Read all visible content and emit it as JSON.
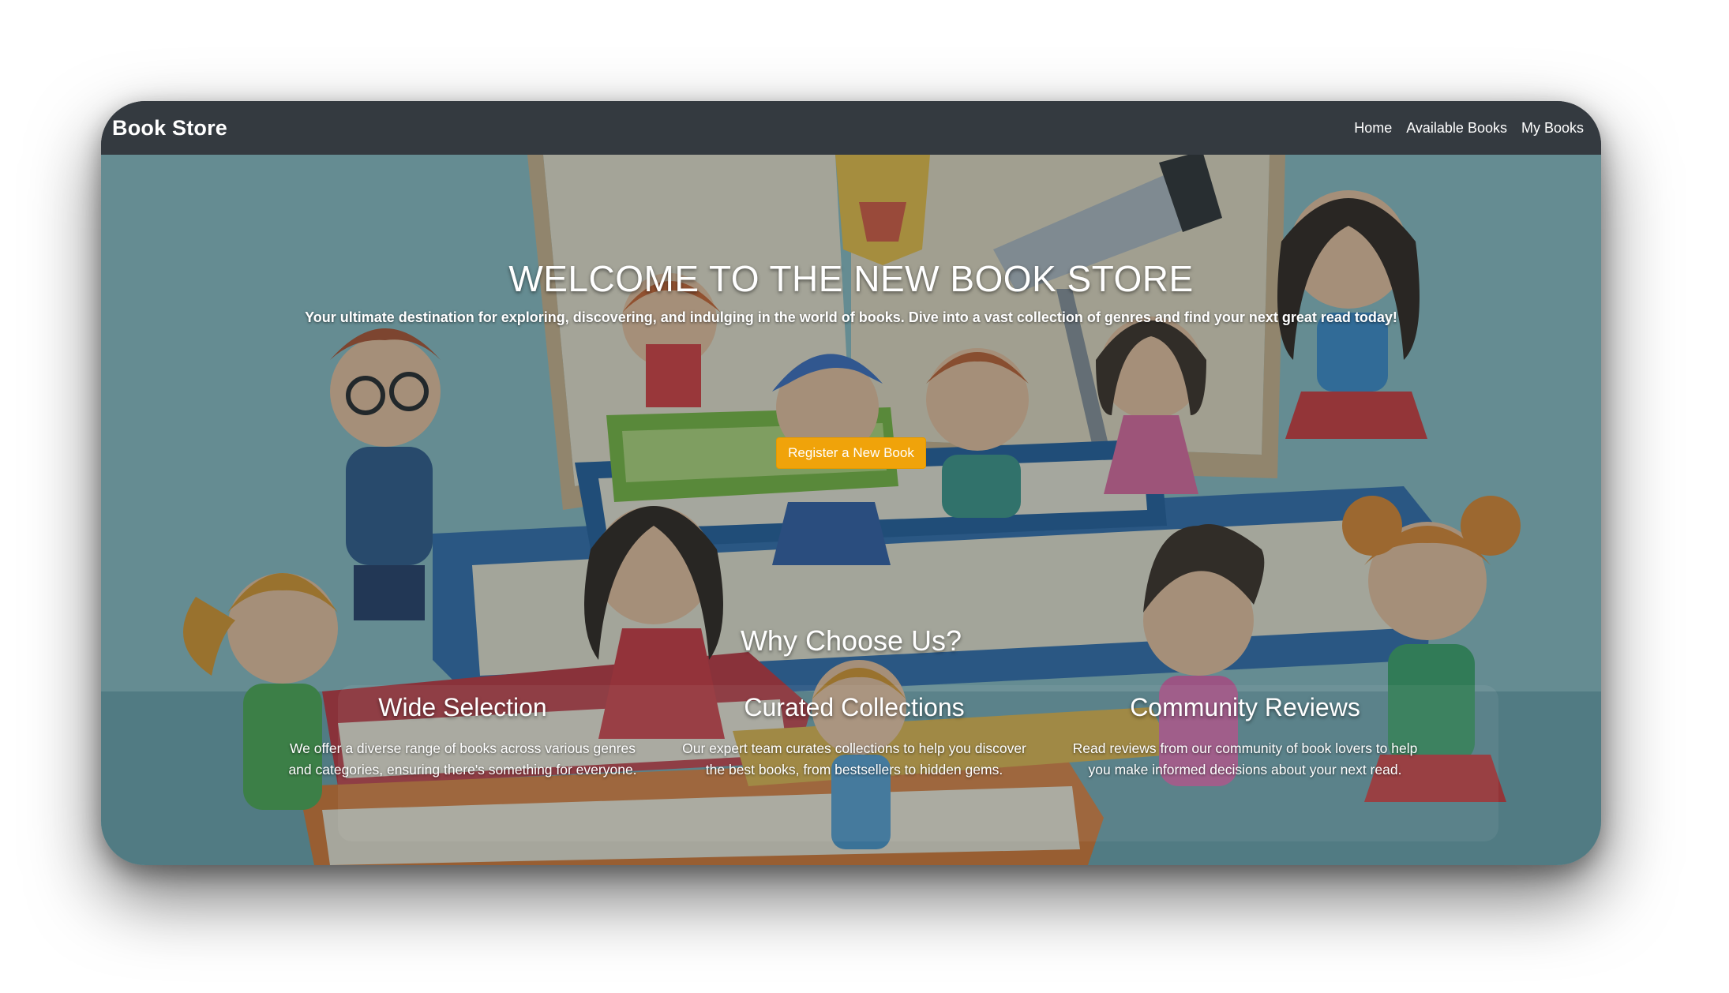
{
  "navbar": {
    "brand": "Book Store",
    "links": [
      "Home",
      "Available Books",
      "My Books"
    ]
  },
  "hero": {
    "title": "WELCOME TO THE NEW BOOK STORE",
    "subtitle": "Your ultimate destination for exploring, discovering, and indulging in the world of books. Dive into a vast collection of genres and find your next great read today!",
    "cta_label": "Register a New Book",
    "background": "kids-reading-books-illustration"
  },
  "why": {
    "title": "Why Choose Us?",
    "features": [
      {
        "title": "Wide Selection",
        "text": "We offer a diverse range of books across various genres and categories, ensuring there's something for everyone."
      },
      {
        "title": "Curated Collections",
        "text": "Our expert team curates collections to help you discover the best books, from bestsellers to hidden gems."
      },
      {
        "title": "Community Reviews",
        "text": "Read reviews from our community of book lovers to help you make informed decisions about your next read."
      }
    ]
  },
  "colors": {
    "navbar": "#343a40",
    "cta": "#f0a30a",
    "text": "#ffffff"
  }
}
